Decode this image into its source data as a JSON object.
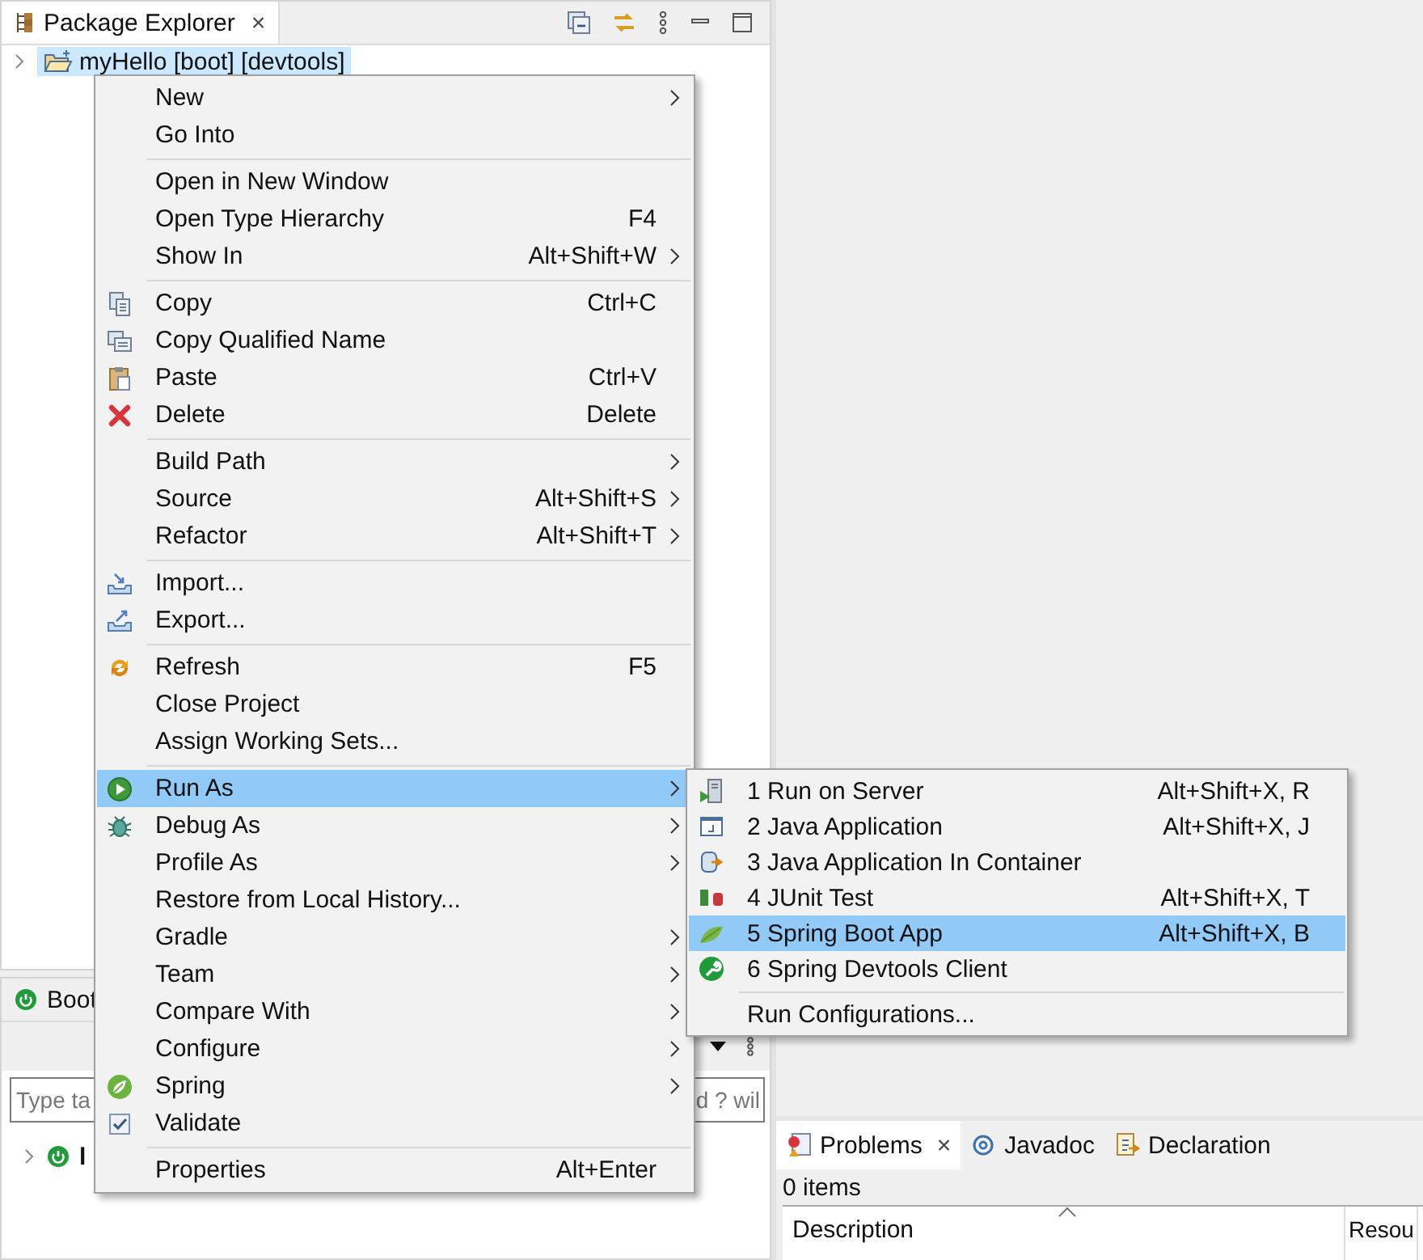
{
  "explorer": {
    "title": "Package Explorer",
    "close": "×",
    "tree": [
      {
        "label": "myHello [boot] [devtools]",
        "selected": true
      }
    ]
  },
  "boot_dashboard": {
    "title": "Boot",
    "search": {
      "placeholder": "Type ta",
      "tail": "d ? wil"
    },
    "tree": [
      {
        "label": "l"
      }
    ]
  },
  "context_menu": {
    "groups": [
      {
        "items": [
          {
            "label": "New",
            "submenu": true,
            "selected": false
          },
          {
            "label": "Go Into",
            "submenu": false,
            "selected": false
          }
        ]
      },
      {
        "items": [
          {
            "label": "Open in New Window",
            "submenu": false,
            "selected": false
          },
          {
            "label": "Open Type Hierarchy",
            "shortcut": "F4",
            "submenu": false,
            "selected": false
          },
          {
            "label": "Show In",
            "shortcut": "Alt+Shift+W",
            "submenu": true,
            "selected": false
          }
        ]
      },
      {
        "items": [
          {
            "label": "Copy",
            "shortcut": "Ctrl+C",
            "kind": "copy",
            "submenu": false,
            "selected": false
          },
          {
            "label": "Copy Qualified Name",
            "kind": "copy2",
            "submenu": false,
            "selected": false
          },
          {
            "label": "Paste",
            "shortcut": "Ctrl+V",
            "kind": "paste",
            "submenu": false,
            "selected": false
          },
          {
            "label": "Delete",
            "shortcut": "Delete",
            "kind": "delete",
            "submenu": false,
            "selected": false
          }
        ]
      },
      {
        "items": [
          {
            "label": "Build Path",
            "submenu": true,
            "selected": false
          },
          {
            "label": "Source",
            "shortcut": "Alt+Shift+S",
            "submenu": true,
            "selected": false
          },
          {
            "label": "Refactor",
            "shortcut": "Alt+Shift+T",
            "submenu": true,
            "selected": false
          }
        ]
      },
      {
        "items": [
          {
            "label": "Import...",
            "kind": "import",
            "submenu": false,
            "selected": false
          },
          {
            "label": "Export...",
            "kind": "export",
            "submenu": false,
            "selected": false
          }
        ]
      },
      {
        "items": [
          {
            "label": "Refresh",
            "shortcut": "F5",
            "kind": "refresh",
            "submenu": false,
            "selected": false
          },
          {
            "label": "Close Project",
            "submenu": false,
            "selected": false
          },
          {
            "label": "Assign Working Sets...",
            "submenu": false,
            "selected": false
          }
        ]
      },
      {
        "items": [
          {
            "label": "Run As",
            "kind": "run",
            "submenu": true,
            "selected": true
          },
          {
            "label": "Debug As",
            "kind": "debug",
            "submenu": true,
            "selected": false
          },
          {
            "label": "Profile As",
            "submenu": true,
            "selected": false
          },
          {
            "label": "Restore from Local History...",
            "submenu": false,
            "selected": false
          },
          {
            "label": "Gradle",
            "submenu": true,
            "selected": false
          },
          {
            "label": "Team",
            "submenu": true,
            "selected": false
          },
          {
            "label": "Compare With",
            "submenu": true,
            "selected": false
          },
          {
            "label": "Configure",
            "submenu": true,
            "selected": false
          },
          {
            "label": "Spring",
            "kind": "spring",
            "submenu": true,
            "selected": false
          },
          {
            "label": "Validate",
            "kind": "validate",
            "submenu": false,
            "selected": false
          }
        ]
      },
      {
        "items": [
          {
            "label": "Properties",
            "shortcut": "Alt+Enter",
            "submenu": false,
            "selected": false
          }
        ]
      }
    ]
  },
  "run_as_menu": {
    "groups": [
      {
        "items": [
          {
            "label": "1 Run on Server",
            "shortcut": "Alt+Shift+X, R",
            "kind": "server",
            "selected": false
          },
          {
            "label": "2 Java Application",
            "shortcut": "Alt+Shift+X, J",
            "kind": "java",
            "selected": false
          },
          {
            "label": "3 Java Application In Container",
            "kind": "container",
            "selected": false
          },
          {
            "label": "4 JUnit Test",
            "shortcut": "Alt+Shift+X, T",
            "kind": "junit",
            "selected": false
          },
          {
            "label": "5 Spring Boot App",
            "shortcut": "Alt+Shift+X, B",
            "kind": "boot",
            "selected": true
          },
          {
            "label": "6 Spring Devtools Client",
            "kind": "devtools",
            "selected": false
          }
        ]
      },
      {
        "items": [
          {
            "label": "Run Configurations...",
            "selected": false
          }
        ]
      }
    ]
  },
  "problems": {
    "tabs": [
      {
        "label": "Problems",
        "kind": "problems",
        "close": "×",
        "selected": true
      },
      {
        "label": "Javadoc",
        "kind": "javadoc",
        "selected": false
      },
      {
        "label": "Declaration",
        "kind": "declaration",
        "selected": false
      }
    ],
    "summary": "0 items",
    "columns": [
      "Description",
      "Resou"
    ]
  }
}
